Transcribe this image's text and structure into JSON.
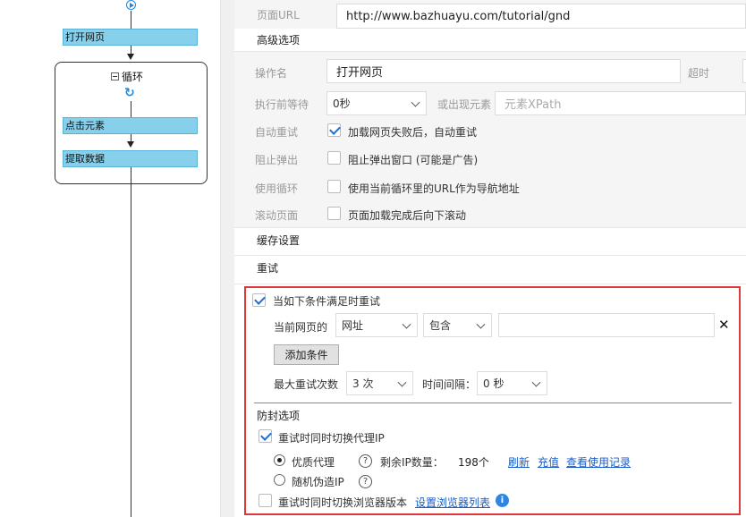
{
  "flow": {
    "nodes": {
      "open_page": "打开网页",
      "loop": "循环",
      "click_element": "点击元素",
      "extract_data": "提取数据"
    }
  },
  "panel": {
    "page_url_label": "页面URL",
    "page_url_value": "http://www.bazhuayu.com/tutorial/gnd",
    "advanced_options": "高级选项",
    "operation_name_label": "操作名",
    "operation_name_value": "打开网页",
    "timeout_label": "超时",
    "wait_before_label": "执行前等待",
    "wait_before_value": "0秒",
    "or_element_appears_label": "或出现元素",
    "xpath_placeholder": "元素XPath",
    "auto_retry_label": "自动重试",
    "auto_retry_text": "加载网页失败后，自动重试",
    "auto_retry_checked": true,
    "block_popup_label": "阻止弹出",
    "block_popup_text": "阻止弹出窗口 (可能是广告)",
    "block_popup_checked": false,
    "use_loop_label": "使用循环",
    "use_loop_text": "使用当前循环里的URL作为导航地址",
    "use_loop_checked": false,
    "scroll_label": "滚动页面",
    "scroll_text": "页面加载完成后向下滚动",
    "scroll_checked": false,
    "cache_settings": "缓存设置",
    "retry_section": "重试"
  },
  "retry": {
    "condition_checkbox_text": "当如下条件满足时重试",
    "condition_checked": true,
    "current_page_label": "当前网页的",
    "field_select": "网址",
    "op_select": "包含",
    "condition_value": "",
    "remove_symbol": "✕",
    "add_condition_button": "添加条件",
    "max_retries_label": "最大重试次数",
    "max_retries_value": "3 次",
    "interval_label": "时间间隔：",
    "interval_value": "0 秒",
    "anti_block_title": "防封选项",
    "switch_proxy_text": "重试时同时切换代理IP",
    "switch_proxy_checked": true,
    "premium_proxy_text": "优质代理",
    "premium_proxy_selected": true,
    "remaining_ip_label": "剩余IP数量：",
    "remaining_ip_value": "198个",
    "refresh_link": "刷新",
    "recharge_link": "充值",
    "usage_link": "查看使用记录",
    "random_ip_text": "随机伪造IP",
    "random_ip_selected": false,
    "switch_browser_text": "重试时同时切换浏览器版本",
    "switch_browser_checked": false,
    "browser_list_link": "设置浏览器列表"
  },
  "colors": {
    "node_fill": "#86d0ec",
    "highlight_border": "#e0383a",
    "link": "#1a5cc8",
    "check": "#1f6fd1"
  }
}
